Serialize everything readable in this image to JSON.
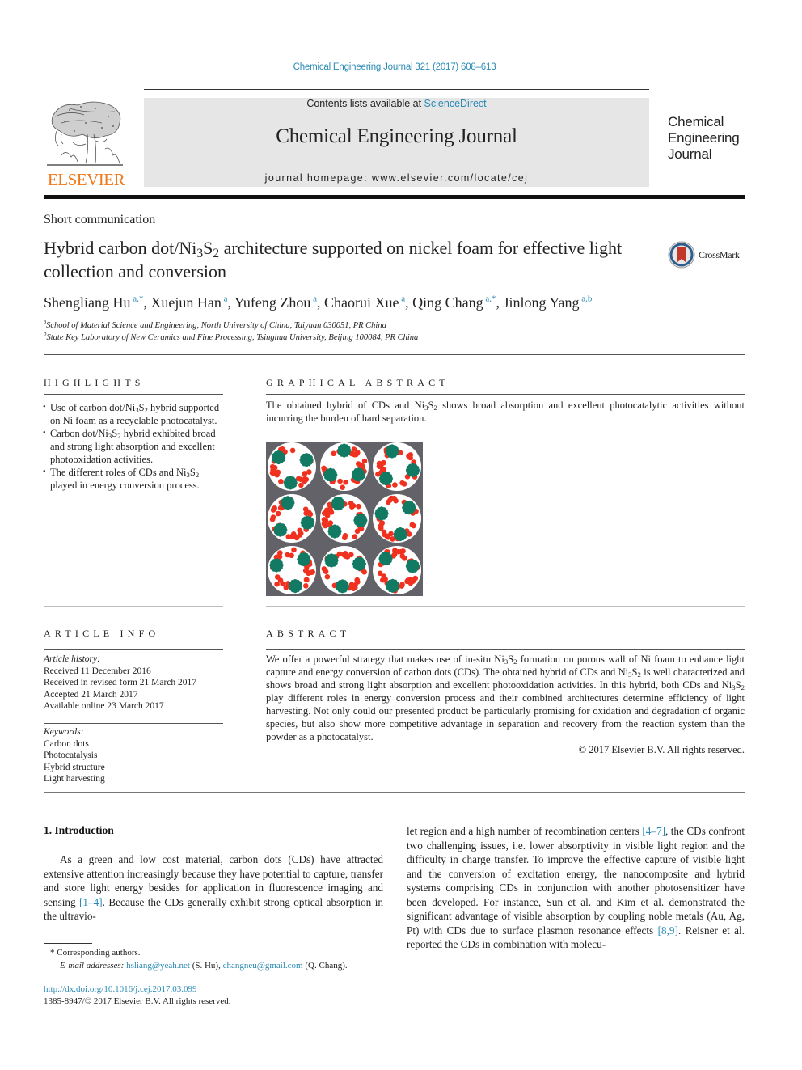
{
  "citation": "Chemical Engineering Journal 321 (2017) 608–613",
  "header": {
    "publisher": "ELSEVIER",
    "contents_prefix": "Contents lists available at ",
    "contents_link": "ScienceDirect",
    "journal_name": "Chemical Engineering Journal",
    "homepage_prefix": "journal homepage: ",
    "homepage_url": "www.elsevier.com/locate/cej",
    "cover_logo_lines": [
      "Chemical",
      "Engineering",
      "Journal"
    ]
  },
  "article": {
    "type": "Short communication",
    "title_part1": "Hybrid carbon dot/Ni",
    "title_sub1": "3",
    "title_part2": "S",
    "title_sub2": "2",
    "title_part3": " architecture supported on nickel foam for effective light collection and conversion",
    "crossmark_label": "CrossMark",
    "authors": [
      {
        "name": "Shengliang Hu",
        "aff": "a,*"
      },
      {
        "name": "Xuejun Han",
        "aff": "a"
      },
      {
        "name": "Yufeng Zhou",
        "aff": "a"
      },
      {
        "name": "Chaorui Xue",
        "aff": "a"
      },
      {
        "name": "Qing Chang",
        "aff": "a,*"
      },
      {
        "name": "Jinlong Yang",
        "aff": "a,b"
      }
    ],
    "affiliations": [
      {
        "key": "a",
        "text": "School of Material Science and Engineering, North University of China, Taiyuan 030051, PR China"
      },
      {
        "key": "b",
        "text": "State Key Laboratory of New Ceramics and Fine Processing, Tsinghua University, Beijing 100084, PR China"
      }
    ]
  },
  "highlights": {
    "heading": "HIGHLIGHTS",
    "items": [
      {
        "pre": "Use of carbon dot/Ni",
        "s1": "3",
        "mid": "S",
        "s2": "2",
        "post": " hybrid supported on Ni foam as a recyclable photocatalyst."
      },
      {
        "pre": "Carbon dot/Ni",
        "s1": "3",
        "mid": "S",
        "s2": "2",
        "post": " hybrid exhibited broad and strong light absorption and excellent photooxidation activities."
      },
      {
        "pre": "The different roles of CDs and Ni",
        "s1": "3",
        "mid": "S",
        "s2": "2",
        "post": " played in energy conversion process."
      }
    ]
  },
  "graphical_abstract": {
    "heading": "GRAPHICAL ABSTRACT",
    "text_pre": "The obtained hybrid of CDs and Ni",
    "text_s1": "3",
    "text_mid": "S",
    "text_s2": "2",
    "text_post": " shows broad absorption and excellent photocatalytic activities without incurring the burden of hard separation.",
    "image_colors": {
      "background": "#636268",
      "pore": "#ffffff",
      "carbon_dot": "#f0311f",
      "ni3s2": "#127a63"
    }
  },
  "article_info": {
    "heading": "ARTICLE INFO",
    "history_label": "Article history:",
    "history": [
      "Received 11 December 2016",
      "Received in revised form 21 March 2017",
      "Accepted 21 March 2017",
      "Available online 23 March 2017"
    ],
    "keywords_label": "Keywords:",
    "keywords": [
      "Carbon dots",
      "Photocatalysis",
      "Hybrid structure",
      "Light harvesting"
    ]
  },
  "abstract": {
    "heading": "ABSTRACT",
    "p1": "We offer a powerful strategy that makes use of in-situ Ni",
    "p2": " formation on porous wall of Ni foam to enhance light capture and energy conversion of carbon dots (CDs). The obtained hybrid of CDs and Ni",
    "p3": " is well characterized and shows broad and strong light absorption and excellent photooxidation activities. In this hybrid, both CDs and Ni",
    "p4": " play different roles in energy conversion process and their combined architectures determine efficiency of light harvesting. Not only could our presented product be particularly promising for oxidation and degradation of organic species, but also show more competitive advantage in separation and recovery from the reaction system than the powder as a photocatalyst.",
    "sub3": "3",
    "S": "S",
    "sub2": "2",
    "copyright": "© 2017 Elsevier B.V. All rights reserved."
  },
  "introduction": {
    "heading": "1. Introduction",
    "left_pre": "As a green and low cost material, carbon dots (CDs) have attracted extensive attention increasingly because they have potential to capture, transfer and store light energy besides for application in fluorescence imaging and sensing ",
    "left_ref": "[1–4]",
    "left_post": ". Because the CDs generally exhibit strong optical absorption in the ultravio-",
    "right_pre": "let region and a high number of recombination centers ",
    "right_ref1": "[4–7]",
    "right_mid": ", the CDs confront two challenging issues, i.e. lower absorptivity in visible light region and the difficulty in charge transfer. To improve the effective capture of visible light and the conversion of excitation energy, the nanocomposite and hybrid systems comprising CDs in conjunction with another photosensitizer have been developed. For instance, Sun et al. and Kim et al. demonstrated the significant advantage of visible absorption by coupling noble metals (Au, Ag, Pt) with CDs due to surface plasmon resonance effects ",
    "right_ref2": "[8,9]",
    "right_post": ". Reisner et al. reported the CDs in combination with molecu-"
  },
  "footnotes": {
    "corresponding": "* Corresponding authors.",
    "email_label": "E-mail addresses:",
    "email1": "hsliang@yeah.net",
    "email1_owner": " (S. Hu), ",
    "email2": "changneu@gmail.com",
    "email2_owner": " (Q. Chang).",
    "doi": "http://dx.doi.org/10.1016/j.cej.2017.03.099",
    "issn_copyright": "1385-8947/© 2017 Elsevier B.V. All rights reserved."
  }
}
